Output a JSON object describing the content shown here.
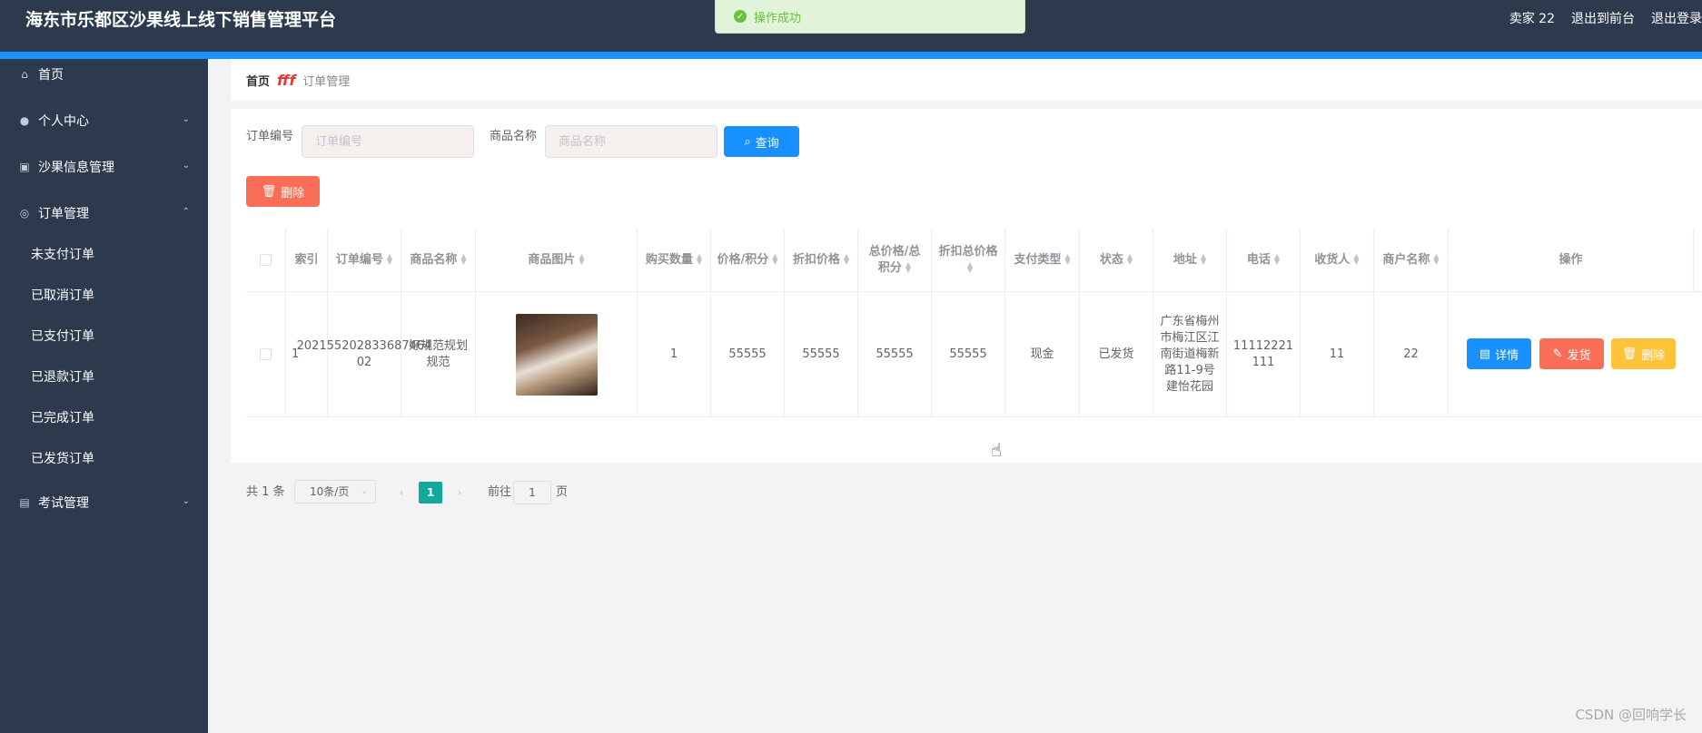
{
  "header": {
    "title": "海东市乐都区沙果线上线下销售管理平台",
    "user_label": "卖家 22",
    "to_front_label": "退出到前台",
    "logout_label": "退出登录"
  },
  "toast": {
    "message": "操作成功"
  },
  "sidebar": {
    "items": [
      {
        "label": "首页",
        "icon": "home-icon"
      },
      {
        "label": "个人中心",
        "icon": "user-icon"
      },
      {
        "label": "沙果信息管理",
        "icon": "chart-icon"
      },
      {
        "label": "订单管理",
        "icon": "order-icon"
      },
      {
        "label": "考试管理",
        "icon": "clipboard-icon"
      }
    ],
    "sub_items": [
      "未支付订单",
      "已取消订单",
      "已支付订单",
      "已退款订单",
      "已完成订单",
      "已发货订单"
    ]
  },
  "breadcrumb": {
    "home": "首页",
    "separator": "fff",
    "current": "订单管理"
  },
  "search": {
    "order_no_label": "订单编号",
    "order_no_placeholder": "订单编号",
    "product_label": "商品名称",
    "product_placeholder": "商品名称",
    "query_label": "查询"
  },
  "toolbar": {
    "delete_label": "删除"
  },
  "table": {
    "headers": [
      "索引",
      "订单编号",
      "商品名称",
      "商品图片",
      "购买数量",
      "价格/积分",
      "折扣价格",
      "总价格/总积分",
      "折扣总价格",
      "支付类型",
      "状态",
      "地址",
      "电话",
      "收货人",
      "商户名称",
      "操作"
    ],
    "rows": [
      {
        "index": "1",
        "order_no": "202155202833687464 02",
        "product": "好规范规划规范",
        "quantity": "1",
        "price": "55555",
        "discount_price": "55555",
        "total": "55555",
        "discount_total": "55555",
        "pay_type": "现金",
        "status": "已发货",
        "address": "广东省梅州市梅江区江南街道梅新路11-9号建怡花园",
        "phone": "11112221111",
        "receiver": "11",
        "merchant": "22"
      }
    ],
    "actions": {
      "detail": "详情",
      "ship": "发货",
      "delete": "删除"
    }
  },
  "pagination": {
    "total": "共 1 条",
    "page_size": "10条/页",
    "current_page": "1",
    "goto_prefix": "前往",
    "goto_value": "1",
    "goto_suffix": "页"
  },
  "watermark": "CSDN @回响学长",
  "colors": {
    "header_bg": "#2d3a4d",
    "accent": "#1890ff",
    "danger": "#fa6e57",
    "warning": "#fcc33b",
    "success": "#67c23a",
    "page_active": "#13a89e"
  }
}
